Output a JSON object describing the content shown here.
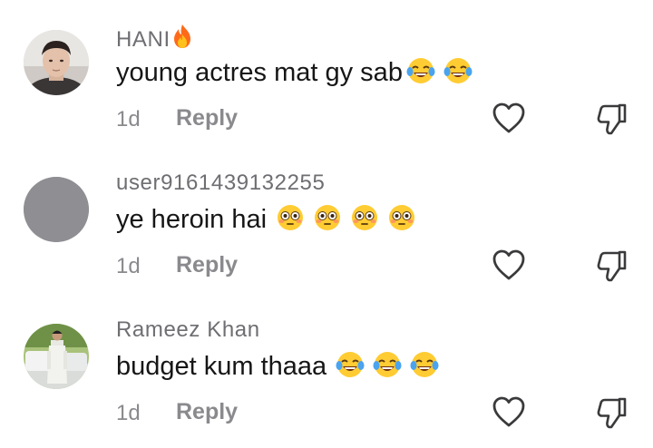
{
  "comments": [
    {
      "username": "HANI",
      "username_icon": "fire-emoji",
      "text": "young actres mat gy sab",
      "emojis": [
        "tears-of-joy-emoji",
        "tears-of-joy-emoji"
      ],
      "time": "1d",
      "reply_label": "Reply",
      "avatar": "young-man-photo"
    },
    {
      "username": "user9161439132255",
      "text": "ye heroin hai",
      "emojis": [
        "flushed-face-emoji",
        "flushed-face-emoji",
        "flushed-face-emoji",
        "flushed-face-emoji"
      ],
      "time": "1d",
      "reply_label": "Reply",
      "avatar": "default-gray-avatar"
    },
    {
      "username": "Rameez Khan",
      "text": "budget kum thaaa",
      "emojis": [
        "tears-of-joy-emoji",
        "tears-of-joy-emoji",
        "tears-of-joy-emoji"
      ],
      "time": "1d",
      "reply_label": "Reply",
      "avatar": "man-standing-outdoors-photo"
    }
  ],
  "icons": {
    "like": "heart-outline-icon",
    "dislike": "thumbs-down-outline-icon"
  },
  "colors": {
    "username": "#6e6e73",
    "text": "#161616",
    "meta": "#8a8a8e",
    "icon": "#3a3a3c",
    "default_avatar": "#8e8e93"
  }
}
